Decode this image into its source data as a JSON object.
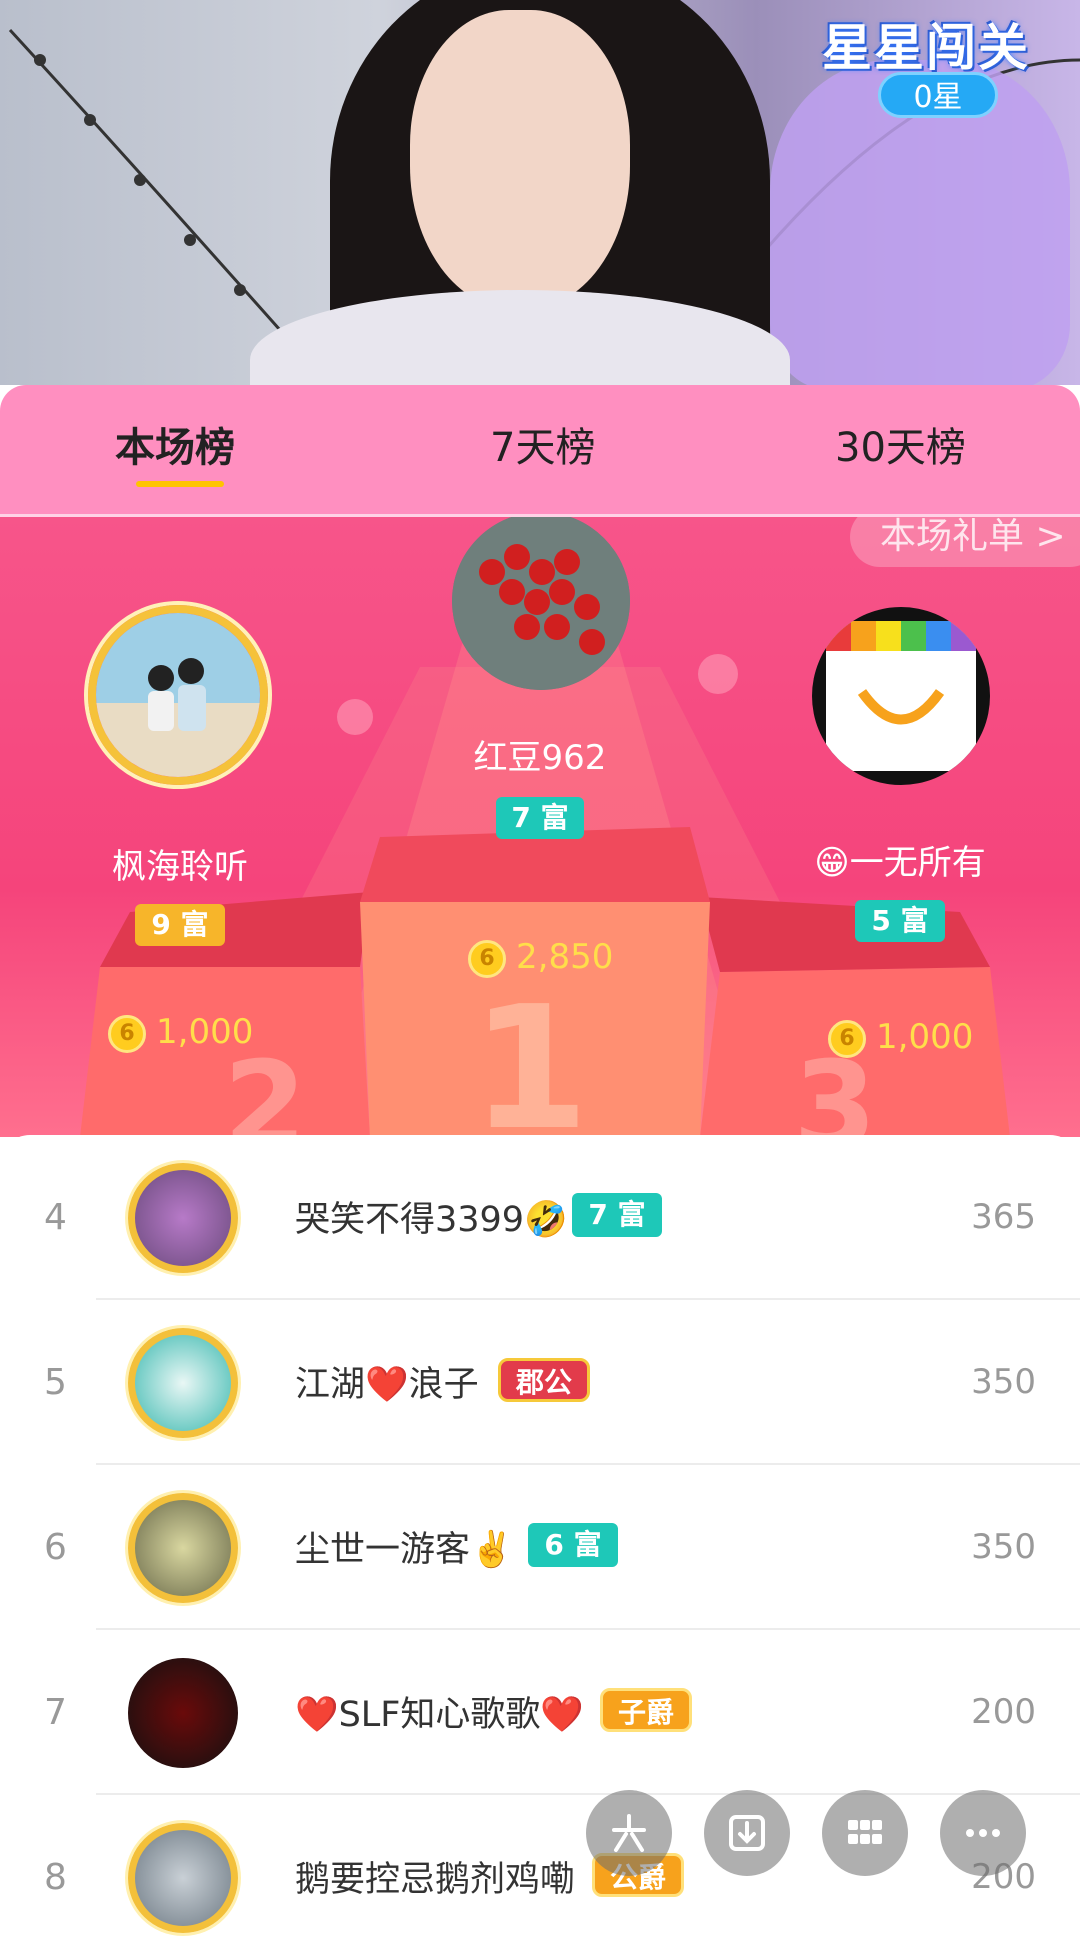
{
  "stream": {
    "challenge_title": "星星闯关",
    "challenge_stars": "0星"
  },
  "tabs": [
    {
      "label": "本场榜",
      "active": true
    },
    {
      "label": "7天榜",
      "active": false
    },
    {
      "label": "30天榜",
      "active": false
    }
  ],
  "gift_wall_label": "本场礼单 >",
  "podium": {
    "first": {
      "name": "红豆962",
      "badge": "7 富",
      "coins": "2,850"
    },
    "second": {
      "name": "枫海聆听",
      "badge": "9 富",
      "coins": "1,000"
    },
    "third": {
      "name": "😁一无所有",
      "badge": "5 富",
      "coins": "1,000"
    },
    "coin_symbol": "6"
  },
  "ranking": [
    {
      "rank": "4",
      "name": "哭笑不得3399🤣",
      "badge": "7 富",
      "badge_style": "teal",
      "score": "365"
    },
    {
      "rank": "5",
      "name": "江湖❤️浪子",
      "badge": "郡公",
      "badge_style": "red",
      "score": "350"
    },
    {
      "rank": "6",
      "name": "尘世一游客✌️",
      "badge": "6 富",
      "badge_style": "teal",
      "score": "350"
    },
    {
      "rank": "7",
      "name": "❤️SLF知心歌歌❤️",
      "badge": "子爵",
      "badge_style": "orange",
      "score": "200"
    },
    {
      "rank": "8",
      "name": "鹅要控忌鹅剂鸡嘞",
      "badge": "公爵",
      "badge_style": "orange",
      "score": "200"
    }
  ],
  "actions": [
    "share-icon",
    "download-icon",
    "grid-icon",
    "more-icon"
  ]
}
